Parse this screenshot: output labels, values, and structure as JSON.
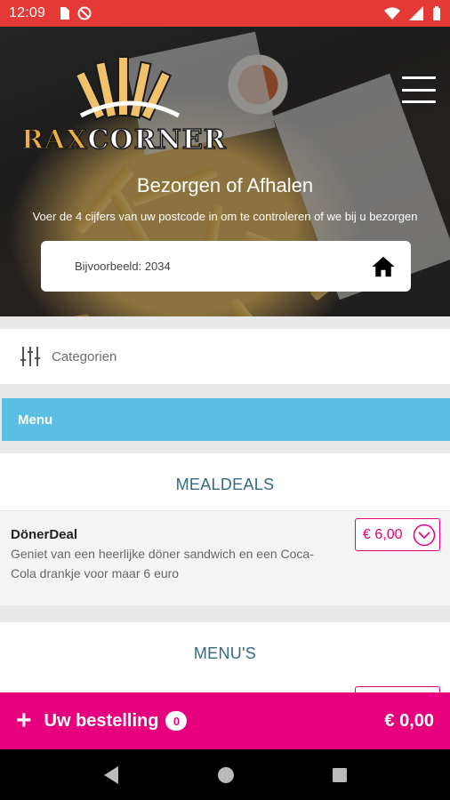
{
  "status_bar": {
    "time": "12:09"
  },
  "hero": {
    "logo_text_1": "RAX",
    "logo_text_2": "CORNER",
    "title": "Bezorgen of Afhalen",
    "subtitle": "Voer de 4 cijfers van uw postcode in om te controleren of we bij u bezorgen",
    "search_placeholder": "Bijvoorbeeld: 2034"
  },
  "categories": {
    "label": "Categorien"
  },
  "menu": {
    "title": "Menu"
  },
  "sections": [
    {
      "title": "MEALDEALS",
      "items": [
        {
          "name": "DönerDeal",
          "description": "Geniet van een heerlijke döner sandwich en een Coca-Cola drankje voor maar 6 euro",
          "price": "€ 6,00"
        }
      ]
    },
    {
      "title": "MENU'S",
      "items": []
    }
  ],
  "order_bar": {
    "label": "Uw bestelling",
    "count": "0",
    "total": "€ 0,00"
  },
  "colors": {
    "status_bar": "#e53935",
    "accent": "#e6007e",
    "menu_bar": "#5bbfe3",
    "section_title": "#356a80"
  }
}
